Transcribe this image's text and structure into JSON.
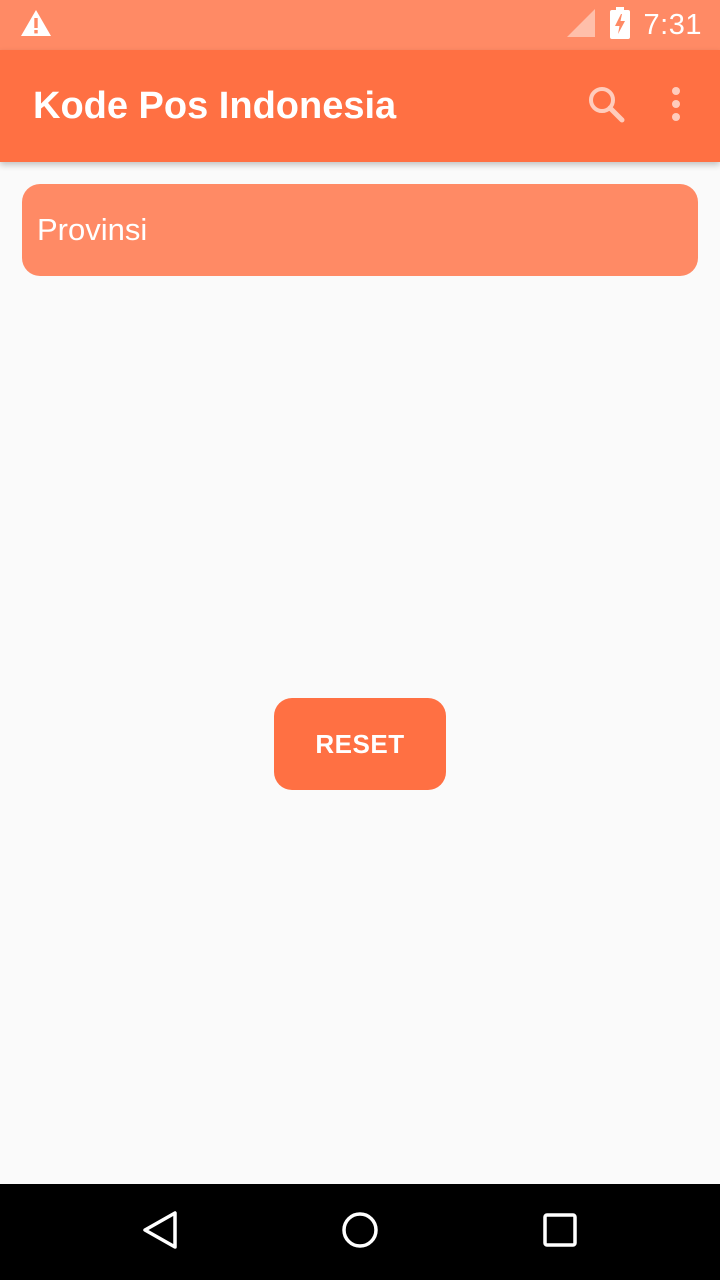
{
  "status_bar": {
    "time": "7:31",
    "icons": [
      "warning-icon",
      "signal-icon",
      "battery-charging-icon"
    ]
  },
  "app_bar": {
    "title": "Kode Pos Indonesia",
    "actions": [
      "search-icon",
      "more-vert-icon"
    ]
  },
  "form": {
    "province_label": "Provinsi",
    "reset_label": "RESET"
  },
  "nav_bar": {
    "buttons": [
      "back-icon",
      "home-icon",
      "recents-icon"
    ]
  },
  "colors": {
    "status_bar": "#ff8a65",
    "app_bar": "#ff7043",
    "field": "#ff8a65",
    "button": "#ff7043",
    "background": "#fafafa",
    "nav_bar": "#000000"
  }
}
